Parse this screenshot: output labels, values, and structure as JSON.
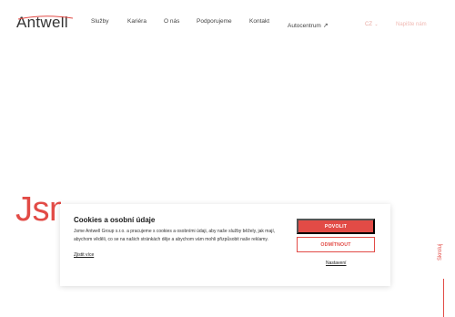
{
  "header": {
    "logo_text": "Antwell",
    "nav": [
      "Služby",
      "Kariéra",
      "O nás",
      "Podporujeme",
      "Kontakt",
      "Autocentrum"
    ],
    "nav_external_icon": "external-link-icon",
    "language": "CZ",
    "contact_cta": "Napište nám"
  },
  "hero": {
    "title": "Jsme"
  },
  "scroll": {
    "label": "Skroluj"
  },
  "cookie": {
    "title": "Cookies a osobní údaje",
    "text": "Jsme Antwell Group s.r.o. a pracujeme s cookies a osobními údaji, aby naše služby běžely, jak mají, abychom věděli, co se na našich stránkách děje a abychom vám mohli přizpůsobit naše reklamy.",
    "details_link": "Zjistit více",
    "allow_button": "POVOLIT",
    "deny_button": "ODMÍTNOUT",
    "settings_link": "Nastavení"
  },
  "colors": {
    "accent": "#e24b46",
    "accent_light": "#f0b9b3"
  }
}
